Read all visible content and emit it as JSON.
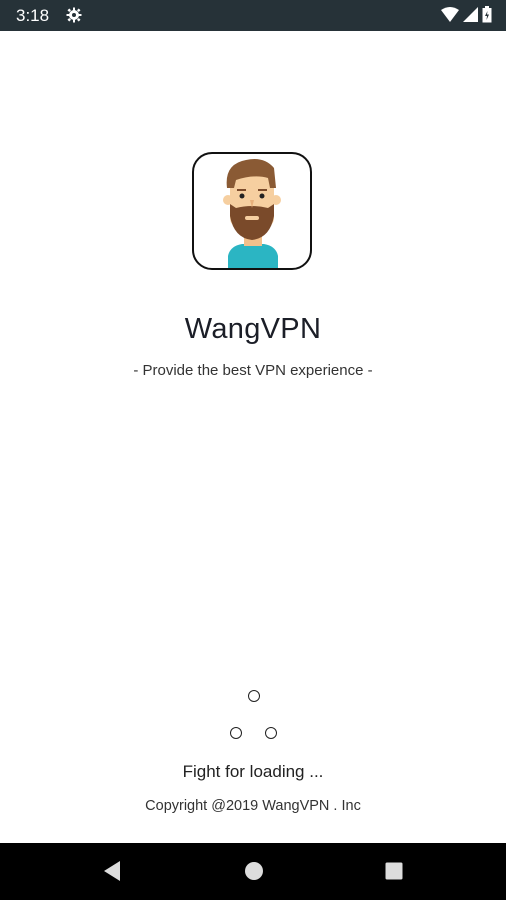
{
  "status_bar": {
    "time": "3:18",
    "icons": [
      "settings-icon",
      "wifi-icon",
      "cell-signal-icon",
      "battery-icon"
    ]
  },
  "app": {
    "icon": "bearded-man-avatar-icon",
    "title": "WangVPN",
    "tagline": "- Provide the best VPN experience -"
  },
  "loading": {
    "text": "Fight for loading ..."
  },
  "footer": {
    "copyright": "Copyright @2019 WangVPN . Inc"
  },
  "nav_bar": {
    "buttons": [
      "back-icon",
      "home-icon",
      "recent-apps-icon"
    ]
  },
  "colors": {
    "status_bar": "#263238",
    "shirt": "#2bb5c3",
    "beard": "#7a4a2a",
    "skin": "#f6cfa0"
  }
}
